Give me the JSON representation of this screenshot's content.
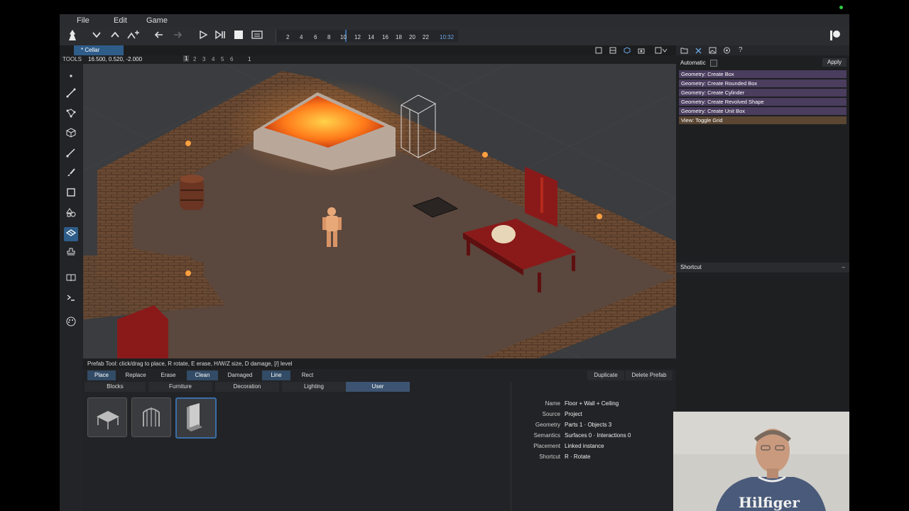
{
  "menu": {
    "file": "File",
    "edit": "Edit",
    "game": "Game"
  },
  "timeline": {
    "ticks": [
      "2",
      "4",
      "6",
      "8",
      "10",
      "12",
      "14",
      "16",
      "18",
      "20",
      "22"
    ],
    "time": "10:32"
  },
  "document_tab": "* Cellar",
  "coord_bar": {
    "tools_label": "TOOLS",
    "coords": "16.500, 0.520, -2.000",
    "levels": [
      "1",
      "2",
      "3",
      "4",
      "5",
      "6"
    ],
    "active_level": "1"
  },
  "status_text": "Prefab Tool: click/drag to place, R rotate, E erase, H/W/Z size, D damage, [/] level",
  "mode_buttons": [
    {
      "label": "Place",
      "active": true
    },
    {
      "label": "Replace",
      "active": false
    },
    {
      "label": "Erase",
      "active": false
    },
    {
      "label": "Clean",
      "active": true
    },
    {
      "label": "Damaged",
      "active": false
    },
    {
      "label": "Line",
      "active": true
    },
    {
      "label": "Rect",
      "active": false
    }
  ],
  "action_buttons": {
    "duplicate": "Duplicate",
    "delete": "Delete Prefab"
  },
  "categories": [
    {
      "label": "Blocks",
      "active": false
    },
    {
      "label": "Furniture",
      "active": false
    },
    {
      "label": "Decoration",
      "active": false
    },
    {
      "label": "Lighting",
      "active": false
    },
    {
      "label": "User",
      "active": true
    }
  ],
  "properties": [
    {
      "label": "Name",
      "value": "Floor + Wall + Ceiling"
    },
    {
      "label": "Source",
      "value": "Project"
    },
    {
      "label": "Geometry",
      "value": "Parts 1 · Objects 3"
    },
    {
      "label": "Semantics",
      "value": "Surfaces 0 · Interactions 0"
    },
    {
      "label": "Placement",
      "value": "Linked instance"
    },
    {
      "label": "Shortcut",
      "value": "R · Rotate"
    }
  ],
  "right_panel": {
    "automatic_label": "Automatic",
    "apply_label": "Apply",
    "shortcut_header": "Shortcut",
    "shortcut_items": [
      "Geometry: Create Box",
      "Geometry: Create Rounded Box",
      "Geometry: Create Cylinder",
      "Geometry: Create Revolved Shape",
      "Geometry: Create Unit Box",
      "View: Toggle Grid"
    ]
  },
  "webcam": {
    "shirt_text": "Hilfiger"
  },
  "colors": {
    "accent": "#3a6ea8",
    "tab_active": "#2f5d8a",
    "shortcut_item": "#4a3d5e",
    "shortcut_item_alt": "#5a4632",
    "lava": "#ff7a1a"
  }
}
